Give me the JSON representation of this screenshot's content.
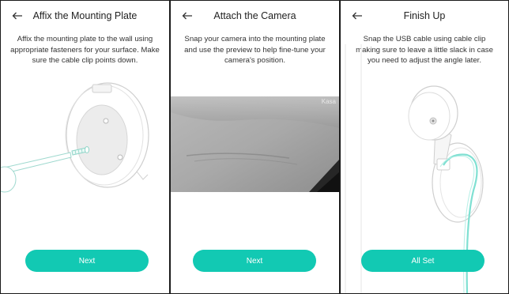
{
  "panels": [
    {
      "title": "Affix the Mounting Plate",
      "description": "Affix the mounting plate to the wall using appropriate fasteners for your surface. Make sure the cable clip points down.",
      "button_label": "Next",
      "back_icon": "back-arrow-icon"
    },
    {
      "title": "Attach the Camera",
      "description": "Snap your camera into the mounting plate and use the preview to help fine-tune your camera's position.",
      "button_label": "Next",
      "back_icon": "back-arrow-icon",
      "preview_watermark": "Kasa"
    },
    {
      "title": "Finish Up",
      "description": "Snap the USB cable using cable clip making sure to leave a little slack in case you need to adjust the angle later.",
      "button_label": "All Set",
      "back_icon": "back-arrow-icon"
    }
  ],
  "colors": {
    "accent": "#12c9b3",
    "cable": "#7fe0d2"
  }
}
